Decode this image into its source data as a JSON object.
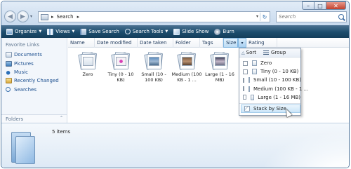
{
  "address": {
    "path_root_glyph": "▸",
    "location": "Search",
    "path_sep_glyph": "▸"
  },
  "search": {
    "placeholder": "Search"
  },
  "toolbar": {
    "organize": "Organize",
    "views": "Views",
    "save_search": "Save Search",
    "search_tools": "Search Tools",
    "slide_show": "Slide Show",
    "burn": "Burn",
    "dropdown_glyph": "▼"
  },
  "sidebar": {
    "heading": "Favorite Links",
    "items": [
      {
        "label": "Documents"
      },
      {
        "label": "Pictures"
      },
      {
        "label": "Music"
      },
      {
        "label": "Recently Changed"
      },
      {
        "label": "Searches"
      }
    ],
    "folders_label": "Folders",
    "folders_chevron": "⌃"
  },
  "columns": {
    "name": "Name",
    "date_modified": "Date modified",
    "date_taken": "Date taken",
    "folder": "Folder",
    "tags": "Tags",
    "size": "Size",
    "rating": "Rating",
    "dropdown_glyph": "▾"
  },
  "stacks": [
    {
      "label": "Zero"
    },
    {
      "label": "Tiny (0 - 10 KB)"
    },
    {
      "label": "Small (10 - 100 KB)"
    },
    {
      "label": "Medium (100 KB - 1 ..."
    },
    {
      "label": "Large (1 - 16 MB)"
    }
  ],
  "menu": {
    "sort_glyph": "△",
    "sort": "Sort",
    "group": "Group",
    "items": [
      {
        "label": "Zero",
        "checked": false
      },
      {
        "label": "Tiny (0 - 10 KB)",
        "checked": false
      },
      {
        "label": "Small (10 - 100 KB)",
        "checked": false
      },
      {
        "label": "Medium (100 KB - 1 ...",
        "checked": false
      },
      {
        "label": "Large (1 - 16 MB)",
        "checked": false
      }
    ],
    "stack_by": "Stack by Size"
  },
  "details": {
    "items_count": "5 items"
  },
  "window": {
    "minimize_glyph": "–",
    "maximize_glyph": "□",
    "close_glyph": "✕",
    "back_glyph": "◀",
    "forward_glyph": "▶",
    "nav_drop_glyph": "▾",
    "addr_drop_glyph": "▾",
    "refresh_glyph": "↻"
  },
  "colors": {
    "toolbar": "#1d4d6d",
    "link": "#1b4e8e",
    "accent": "#7eb4e0"
  }
}
